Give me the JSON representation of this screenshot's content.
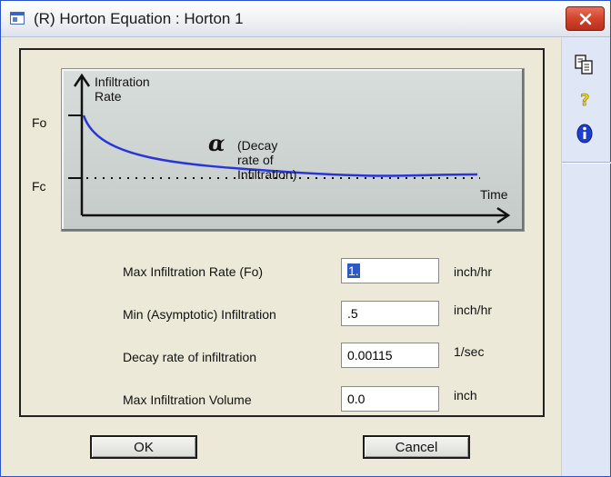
{
  "window": {
    "title": "(R) Horton Equation : Horton 1"
  },
  "toolbar": {
    "items": [
      {
        "icon": "copy-icon"
      },
      {
        "icon": "help-icon",
        "glyph": "?"
      },
      {
        "icon": "info-icon",
        "glyph": "i"
      }
    ]
  },
  "diagram": {
    "y_axis_label": "Infiltration Rate",
    "x_axis_label": "Time",
    "fo_label": "Fo",
    "fc_label": "Fc",
    "alpha_symbol": "α",
    "decay_label": "(Decay rate of Infiltration)",
    "curve_color": "#2a35d8"
  },
  "form": {
    "max_infiltration": {
      "label": "Max Infiltration Rate (Fo)",
      "value": "1.",
      "unit": "inch/hr"
    },
    "min_infiltration": {
      "label": "Min (Asymptotic) Infiltration",
      "value": ".5",
      "unit": "inch/hr"
    },
    "decay_rate": {
      "label": "Decay rate of infiltration",
      "value": "0.00115",
      "unit": "1/sec"
    },
    "max_volume": {
      "label": "Max Infiltration Volume",
      "value": "0.0",
      "unit": "inch"
    }
  },
  "buttons": {
    "ok": "OK",
    "cancel": "Cancel"
  }
}
